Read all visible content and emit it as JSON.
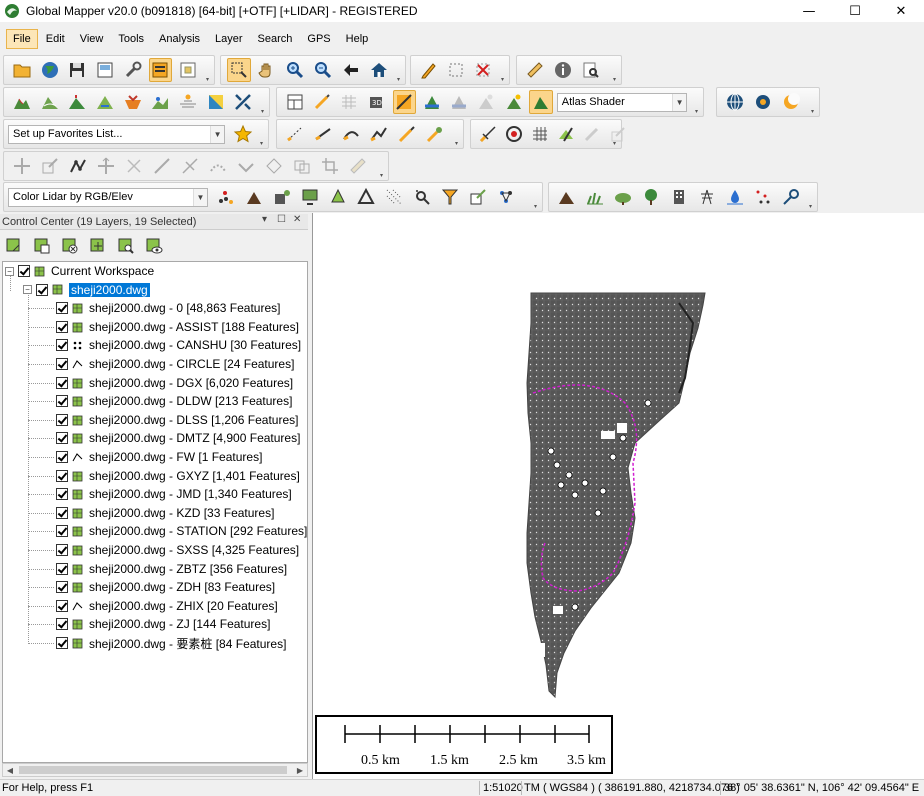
{
  "window": {
    "title": "Global Mapper v20.0 (b091818) [64-bit] [+OTF] [+LIDAR] - REGISTERED",
    "minimize": "—",
    "maximize": "☐",
    "close": "✕"
  },
  "menu": [
    "File",
    "Edit",
    "View",
    "Tools",
    "Analysis",
    "Layer",
    "Search",
    "GPS",
    "Help"
  ],
  "toolbar": {
    "shader_select": "Atlas Shader",
    "favorites_select": "Set up Favorites List...",
    "lidar_color_select": "Color Lidar by RGB/Elev"
  },
  "control_center": {
    "title": "Control Center (19 Layers, 19 Selected)",
    "pin": "▾",
    "float": "☐",
    "close": "✕",
    "workspace_label": "Current Workspace",
    "file_label": "sheji2000.dwg",
    "layers": [
      "sheji2000.dwg - 0 [48,863 Features]",
      "sheji2000.dwg - ASSIST [188 Features]",
      "sheji2000.dwg - CANSHU [30 Features]",
      "sheji2000.dwg - CIRCLE [24 Features]",
      "sheji2000.dwg - DGX [6,020 Features]",
      "sheji2000.dwg - DLDW [213 Features]",
      "sheji2000.dwg - DLSS [1,206 Features]",
      "sheji2000.dwg - DMTZ [4,900 Features]",
      "sheji2000.dwg - FW [1 Features]",
      "sheji2000.dwg - GXYZ [1,401 Features]",
      "sheji2000.dwg - JMD [1,340 Features]",
      "sheji2000.dwg - KZD [33 Features]",
      "sheji2000.dwg - STATION [292 Features]",
      "sheji2000.dwg - SXSS [4,325 Features]",
      "sheji2000.dwg - ZBTZ [356 Features]",
      "sheji2000.dwg - ZDH [83 Features]",
      "sheji2000.dwg - ZHIX [20 Features]",
      "sheji2000.dwg - ZJ [144 Features]",
      "sheji2000.dwg - 要素桩 [84 Features]"
    ]
  },
  "scalebar": {
    "labels": [
      "0.5 km",
      "1.5 km",
      "2.5 km",
      "3.5 km"
    ]
  },
  "status": {
    "help": "For Help, press F1",
    "scale": "1:51020",
    "projection": "TM ( WGS84 ) ( 386191.880, 4218734.076 )",
    "latlon": "38° 05' 38.6361\" N, 106° 42' 09.4564\" E"
  },
  "colors": {
    "map_features": "#4a4a4a",
    "boundary": "#d020d0",
    "selection": "#0078d7",
    "active_toolbar": "#fbd58b"
  }
}
